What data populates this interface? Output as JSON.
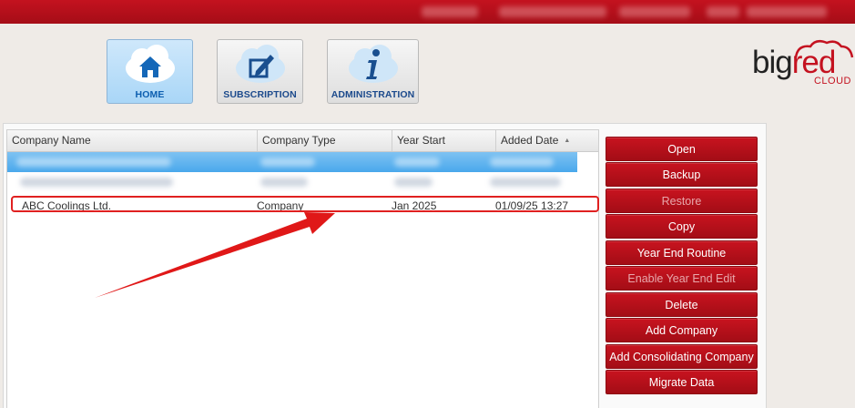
{
  "nav": {
    "tiles": [
      {
        "label": "HOME",
        "icon": "home-icon",
        "active": true
      },
      {
        "label": "SUBSCRIPTION",
        "icon": "edit-icon",
        "active": false
      },
      {
        "label": "ADMINISTRATION",
        "icon": "info-icon",
        "active": false
      }
    ]
  },
  "logo": {
    "big": "big",
    "red": "red",
    "sub": "CLOUD"
  },
  "grid": {
    "columns": [
      "Company Name",
      "Company Type",
      "Year Start",
      "Added Date"
    ],
    "sort_column": "Added Date",
    "sort_direction": "ascending",
    "rows": [
      {
        "company_name": "ABC Coolings Ltd.",
        "company_type": "Company",
        "year_start": "Jan 2025",
        "added_date": "01/09/25 13:27"
      }
    ]
  },
  "actions": {
    "buttons": [
      {
        "label": "Open",
        "enabled": true
      },
      {
        "label": "Backup",
        "enabled": true
      },
      {
        "label": "Restore",
        "enabled": false
      },
      {
        "label": "Copy",
        "enabled": true
      },
      {
        "label": "Year End Routine",
        "enabled": true
      },
      {
        "label": "Enable Year End Edit",
        "enabled": false
      },
      {
        "label": "Delete",
        "enabled": true
      },
      {
        "label": "Add Company",
        "enabled": true
      },
      {
        "label": "Add Consolidating Company",
        "enabled": true
      },
      {
        "label": "Migrate Data",
        "enabled": true
      }
    ]
  },
  "colors": {
    "brand_red": "#c41220",
    "selection_blue": "#49a8ec",
    "annotation_red": "#e02020"
  }
}
